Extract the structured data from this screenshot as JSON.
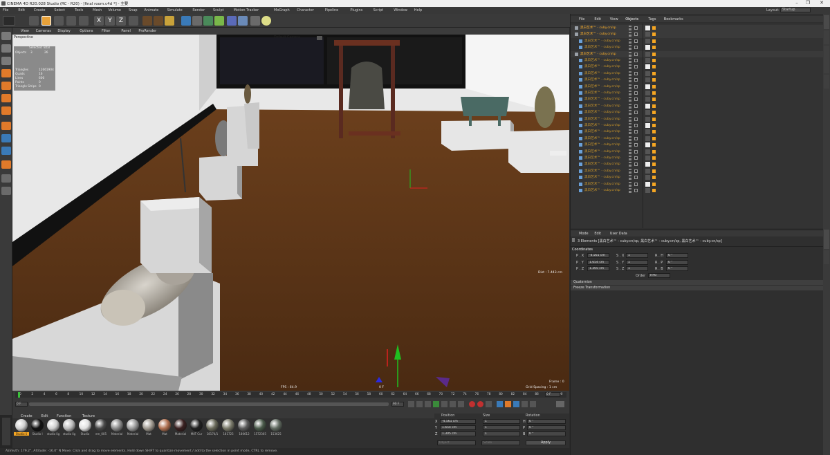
{
  "title_bar": {
    "title": "CINEMA 4D R20.028 Studio (RC - R20) - [final room.c4d *] - 主要",
    "minimize": "–",
    "maximize": "❐",
    "close": "✕"
  },
  "main_menu": [
    "File",
    "Edit",
    "Create",
    "Select",
    "Tools",
    "Mesh",
    "Volume",
    "Snap",
    "Animate",
    "Simulate",
    "Render",
    "Sculpt",
    "Motion Tracker",
    "MoGraph",
    "Character",
    "Pipeline",
    "Plugins",
    "Script",
    "Window",
    "Help"
  ],
  "layout": {
    "label": "Layout:",
    "value": "Startup"
  },
  "viewport": {
    "menu": [
      "View",
      "Cameras",
      "Display",
      "Options",
      "Filter",
      "Panel",
      "ProRender"
    ],
    "name": "Perspective",
    "camera": "Default Camera",
    "camera_icon": "camera-icon",
    "stats": {
      "header": "Selected Total",
      "objects_label": "Objects",
      "objects_selected": "3",
      "objects_total": "26",
      "rows": [
        {
          "label": "Triangles",
          "value": "12661904"
        },
        {
          "label": "Quads",
          "value": "16"
        },
        {
          "label": "Lines",
          "value": "600"
        },
        {
          "label": "Points",
          "value": "0"
        },
        {
          "label": "Triangle Strips",
          "value": "0"
        }
      ]
    },
    "dist": "Dist : 7.443 cm",
    "fps": "FPS : 64.9",
    "frame": "Frame : 0",
    "grid_spacing": "Grid Spacing : 1 cm",
    "axis_f": "0 F"
  },
  "timeline": {
    "ticks": [
      "0",
      "2",
      "4",
      "6",
      "8",
      "10",
      "12",
      "14",
      "16",
      "18",
      "20",
      "22",
      "24",
      "26",
      "28",
      "30",
      "32",
      "34",
      "36",
      "38",
      "40",
      "42",
      "44",
      "46",
      "48",
      "50",
      "52",
      "54",
      "56",
      "58",
      "60",
      "62",
      "64",
      "66",
      "68",
      "70",
      "72",
      "74",
      "76",
      "78",
      "80",
      "82",
      "84",
      "86",
      "88",
      "90"
    ],
    "current_frame_right": "0 F",
    "start_field": "0 F",
    "end_field": "90 F"
  },
  "material_manager": {
    "menu": [
      "Create",
      "Edit",
      "Function",
      "Texture"
    ],
    "materials": [
      {
        "name": "Studio li",
        "color": "#d0d0d0"
      },
      {
        "name": "Studio l",
        "color": "#111111"
      },
      {
        "name": "studio lig",
        "color": "#cfcfcf"
      },
      {
        "name": "studio lig",
        "color": "#bdbdbd"
      },
      {
        "name": "Studio",
        "color": "#e2e2e2"
      },
      {
        "name": "em_005",
        "color": "#4a4a4a"
      },
      {
        "name": "Material",
        "color": "#8a8a8a"
      },
      {
        "name": "Material",
        "color": "#9a9a9a"
      },
      {
        "name": "Mat",
        "color": "#a09a90"
      },
      {
        "name": "Mat",
        "color": "#b07050"
      },
      {
        "name": "Material",
        "color": "#3a2020"
      },
      {
        "name": "MAT Cur",
        "color": "#202020"
      },
      {
        "name": "18174/1",
        "color": "#6a6a5a"
      },
      {
        "name": "181725",
        "color": "#7a7a6a"
      },
      {
        "name": "180612",
        "color": "#5a5a5a"
      },
      {
        "name": "1572305",
        "color": "#4a5a4a"
      },
      {
        "name": "153625",
        "color": "#606a60"
      }
    ]
  },
  "coordinates_panel": {
    "headers": [
      "Position",
      "Size",
      "Rotation"
    ],
    "rows": [
      {
        "axis": "X",
        "pos": "-4.561 cm",
        "size": "1",
        "rot_axis": "H",
        "rot": "0 °"
      },
      {
        "axis": "Y",
        "pos": "1.654 cm",
        "size": "1",
        "rot_axis": "P",
        "rot": "0 °"
      },
      {
        "axis": "Z",
        "pos": "1.305 cm",
        "size": "1",
        "rot_axis": "B",
        "rot": "0 °"
      }
    ],
    "mode_left": "Object",
    "mode_mid": "Scale",
    "apply": "Apply"
  },
  "status_bar": "Azimuth: 179.2°, Altitude: -16.0°  N  Move: Click and drag to move elements. Hold down SHIFT to quantize movement / add to the selection in point mode, CTRL to remove.",
  "object_manager": {
    "menu": [
      "File",
      "Edit",
      "View",
      "Objects",
      "Tags",
      "Bookmarks"
    ],
    "objects": [
      {
        "name": "黑白艺术™ - cuby.cn/sp",
        "indent": 0,
        "selected": true
      },
      {
        "name": "黑白艺术™ - cuby.cn/sp",
        "indent": 0,
        "selected": true
      },
      {
        "name": "黑白艺术™ - cuby.cn/sp",
        "indent": 1,
        "selected": false
      },
      {
        "name": "黑白艺术™ - cuby.cn/sp",
        "indent": 1,
        "selected": false
      },
      {
        "name": "黑白艺术™ - cuby.cn/sp",
        "indent": 0,
        "selected": true
      },
      {
        "name": "黑白艺术™ - cuby.cn/sp",
        "indent": 1,
        "selected": false
      },
      {
        "name": "黑白艺术™ - cuby.cn/sp",
        "indent": 1,
        "selected": false
      },
      {
        "name": "黑白艺术™ - cuby.cn/sp",
        "indent": 1,
        "selected": false
      },
      {
        "name": "黑白艺术™ - cuby.cn/sp",
        "indent": 1,
        "selected": false
      },
      {
        "name": "黑白艺术™ - cuby.cn/sp",
        "indent": 1,
        "selected": false
      },
      {
        "name": "黑白艺术™ - cuby.cn/sp",
        "indent": 1,
        "selected": false
      },
      {
        "name": "黑白艺术™ - cuby.cn/sp",
        "indent": 1,
        "selected": false
      },
      {
        "name": "黑白艺术™ - cuby.cn/sp",
        "indent": 1,
        "selected": false
      },
      {
        "name": "黑白艺术™ - cuby.cn/sp",
        "indent": 1,
        "selected": false
      },
      {
        "name": "黑白艺术™ - cuby.cn/sp",
        "indent": 1,
        "selected": false
      },
      {
        "name": "黑白艺术™ - cuby.cn/sp",
        "indent": 1,
        "selected": false
      },
      {
        "name": "黑白艺术™ - cuby.cn/sp",
        "indent": 1,
        "selected": false
      },
      {
        "name": "黑白艺术™ - cuby.cn/sp",
        "indent": 1,
        "selected": false
      },
      {
        "name": "黑白艺术™ - cuby.cn/sp",
        "indent": 1,
        "selected": false
      },
      {
        "name": "黑白艺术™ - cuby.cn/sp",
        "indent": 1,
        "selected": false
      },
      {
        "name": "黑白艺术™ - cuby.cn/sp",
        "indent": 1,
        "selected": false
      },
      {
        "name": "黑白艺术™ - cuby.cn/sp",
        "indent": 1,
        "selected": false
      },
      {
        "name": "黑白艺术™ - cuby.cn/sp",
        "indent": 1,
        "selected": false
      },
      {
        "name": "黑白艺术™ - cuby.cn/sp",
        "indent": 1,
        "selected": false
      },
      {
        "name": "黑白艺术™ - cuby.cn/sp",
        "indent": 1,
        "selected": false
      },
      {
        "name": "黑白艺术™ - cuby.cn/sp",
        "indent": 1,
        "selected": false
      }
    ]
  },
  "attribute_manager": {
    "menu": [
      "Mode",
      "Edit",
      "User Data"
    ],
    "elements": "3 Elements [黑白艺术™ - cuby.cn/sp, 黑白艺术™ - cuby.cn/sp, 黑白艺术™ - cuby.cn/sp]",
    "section": "Coordinates",
    "rows": [
      {
        "p": "P . X",
        "pv": "-4.561 cm",
        "s": "S . X",
        "sv": "1",
        "r": "R . H",
        "rv": "0 °"
      },
      {
        "p": "P . Y",
        "pv": "1.654 cm",
        "s": "S . Y",
        "sv": "1",
        "r": "R . P",
        "rv": "0 °"
      },
      {
        "p": "P . Z",
        "pv": "1.305 cm",
        "s": "S . Z",
        "sv": "1",
        "r": "R . B",
        "rv": "0 °"
      }
    ],
    "order_label": "Order",
    "order_value": "HPB",
    "collapsed": [
      "Quaternion",
      "Freeze Transformation"
    ]
  },
  "right_strip_tabs": [
    "Objects",
    "Takes",
    "Content Browser",
    "Layers",
    "Attributes",
    "Layers"
  ],
  "colors": {
    "accent": "#f5a623",
    "selected_name": "#ffb12a",
    "name": "#d09a2a",
    "floor": "#5a3518"
  }
}
